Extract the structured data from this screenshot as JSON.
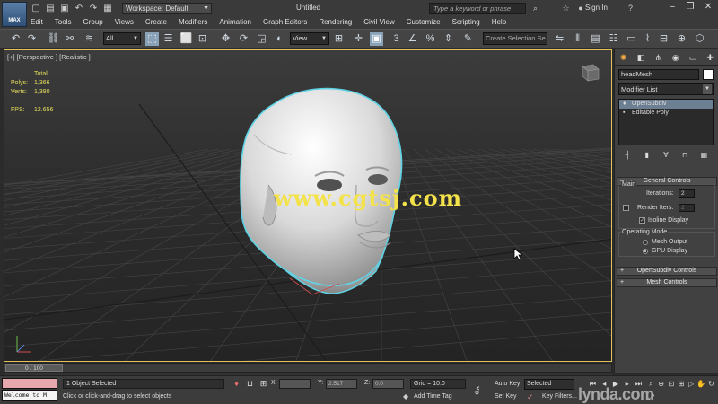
{
  "app": {
    "logo_text": "MAX",
    "workspace": "Workspace: Default",
    "document_title": "Untitled",
    "search_placeholder": "Type a keyword or phrase",
    "sign_in": "Sign In",
    "menu": [
      "Edit",
      "Tools",
      "Group",
      "Views",
      "Create",
      "Modifiers",
      "Animation",
      "Graph Editors",
      "Rendering",
      "Civil View",
      "Customize",
      "Scripting",
      "Help"
    ]
  },
  "toolbar": {
    "selection_filter": "All",
    "reference_coord": "View",
    "named_selection_placeholder": "Create Selection Se",
    "snap_label": "3"
  },
  "viewport": {
    "label": "[+] [Perspective ] [Realistic ]",
    "stats": {
      "header": "Total",
      "polys_label": "Polys:",
      "polys_value": "1,366",
      "verts_label": "Verts:",
      "verts_value": "1,380",
      "fps_label": "FPS:",
      "fps_value": "12.656"
    },
    "watermark": "www.cgtsj.com"
  },
  "command_panel": {
    "object_name": "headMesh",
    "modifier_list": "Modifier List",
    "stack": [
      {
        "label": "OpenSubdiv",
        "selected": true
      },
      {
        "label": "Editable Poly",
        "selected": false
      }
    ],
    "rollouts": {
      "general": "General Controls",
      "opensubdiv": "OpenSubdiv Controls",
      "mesh": "Mesh Controls"
    },
    "main_group": "Main",
    "iterations_label": "Iterations:",
    "iterations_value": "2",
    "render_iters_label": "Render Iters:",
    "render_iters_value": "2",
    "isoline_label": "Isoline Display",
    "operating_mode_group": "Operating Mode",
    "mesh_output_label": "Mesh Output",
    "gpu_display_label": "GPU Display"
  },
  "timeline": {
    "frame_label": "0 / 100"
  },
  "status": {
    "maxscript_text": "Welcome to M",
    "selection": "1 Object Selected",
    "prompt": "Click or click-and-drag to select objects",
    "x_label": "X:",
    "y_label": "Y:",
    "y_value": "2.517",
    "z_label": "Z:",
    "z_value": "0.0",
    "grid": "Grid = 10.0",
    "add_time_tag": "Add Time Tag",
    "auto_key": "Auto Key",
    "set_key": "Set Key",
    "selected_dd": "Selected",
    "key_filters": "Key Filters...",
    "brand": "lynda.com"
  },
  "colors": {
    "viewport_border": "#e0c15b",
    "stats_text": "#e6df5c",
    "selection_outline": "#5fd3e6",
    "watermark": "#f3e24a",
    "maxscript_pink": "#e7a8ad"
  }
}
